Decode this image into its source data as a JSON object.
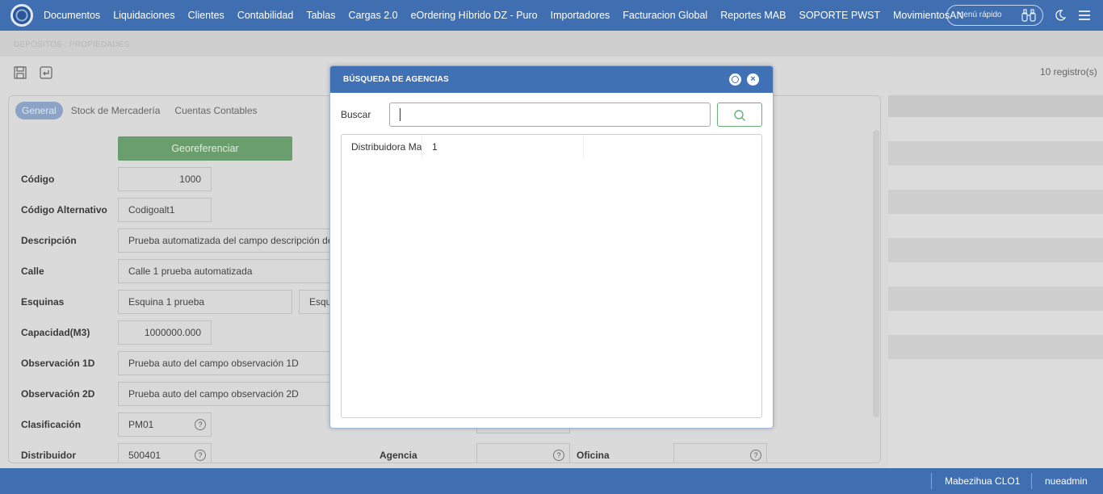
{
  "nav": {
    "items": [
      "Documentos",
      "Liquidaciones",
      "Clientes",
      "Contabilidad",
      "Tablas",
      "Cargas 2.0",
      "eOrdering Híbrido DZ - Puro",
      "Importadores",
      "Facturacion Global",
      "Reportes MAB",
      "SOPORTE PWST",
      "MovimientosAN"
    ],
    "quick_menu": "menú rápido"
  },
  "page": {
    "breadcrumb": "DEPÓSITOS : PROPIEDADES",
    "records": "10 registro(s)",
    "tabs": [
      "General",
      "Stock de Mercadería",
      "Cuentas Contables"
    ],
    "georef_button": "Georeferenciar",
    "fields": {
      "codigo": {
        "label": "Código",
        "value": "1000"
      },
      "codigo_alt": {
        "label": "Código Alternativo",
        "value": "Codigoalt1"
      },
      "descripcion": {
        "label": "Descripción",
        "value": "Prueba automatizada del campo descripción depósito"
      },
      "calle": {
        "label": "Calle",
        "value": "Calle 1 prueba automatizada"
      },
      "esquinas": {
        "label": "Esquinas",
        "value1": "Esquina 1 prueba",
        "value2": "Esquina 2 prueba"
      },
      "capacidad": {
        "label": "Capacidad(M3)",
        "value": "1000000.000"
      },
      "obs1": {
        "label": "Observación 1D",
        "value": "Prueba auto del campo observación 1D"
      },
      "obs2": {
        "label": "Observación 2D",
        "value": "Prueba auto del campo observación 2D"
      },
      "clasificacion": {
        "label": "Clasificación",
        "value": "PM01"
      },
      "distribuidor": {
        "label": "Distribuidor",
        "value": "500401"
      },
      "agencia": {
        "label": "Agencia",
        "value": ""
      },
      "oficina": {
        "label": "Oficina",
        "value": ""
      }
    },
    "help_glyph": "?"
  },
  "modal": {
    "title": "BÚSQUEDA DE AGENCIAS",
    "close_glyph": "×",
    "search_label": "Buscar",
    "search_value": "",
    "results": [
      {
        "name": "Distribuidora Ma",
        "code": "1"
      }
    ]
  },
  "footer": {
    "company": "Mabezihua CLO1",
    "user": "nueadmin"
  },
  "colors": {
    "brand": "#3f6fb0",
    "modal_header": "#4171b5",
    "georef": "#6a9e6f",
    "search_border": "#66b07a"
  }
}
